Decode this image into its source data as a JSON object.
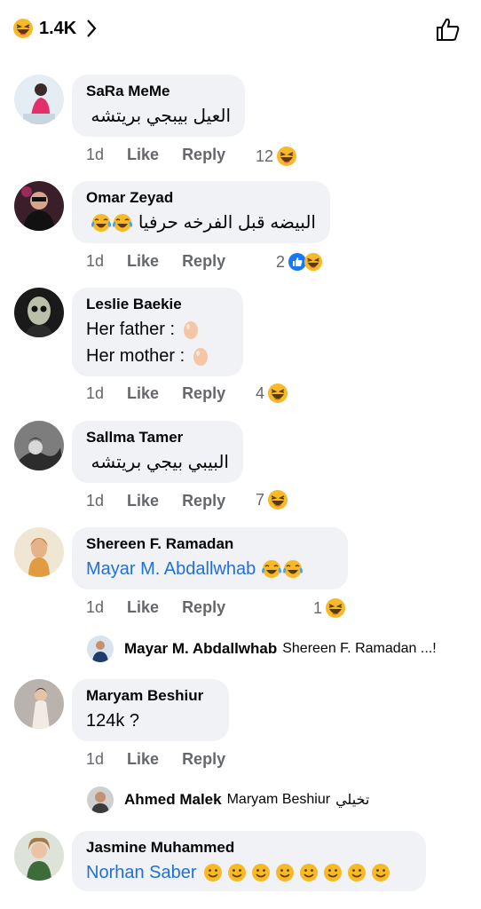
{
  "header": {
    "reaction_count": "1.4K"
  },
  "actions": {
    "time": "1d",
    "like": "Like",
    "reply": "Reply"
  },
  "comments": [
    {
      "name": "SaRa MeMe",
      "text": "العيل بيبجي بريتشه",
      "reactions": "12"
    },
    {
      "name": "Omar Zeyad",
      "text": "البيضه قبل الفرخه حرفيا",
      "reactions": "2"
    },
    {
      "name": "Leslie Baekie",
      "line1": "Her father :",
      "line2": "Her mother :",
      "reactions": "4"
    },
    {
      "name": "Sallma Tamer",
      "text": "البيبي بيجي بريتشه",
      "reactions": "7"
    },
    {
      "name": "Shereen F. Ramadan",
      "text": "Mayar M. Abdallwhab",
      "reactions": "1",
      "reply": {
        "name": "Mayar M. Abdallwhab",
        "text": "Shereen F. Ramadan ...!"
      }
    },
    {
      "name": "Maryam Beshiur",
      "text": "124k ?",
      "reply": {
        "name": "Ahmed Malek",
        "mention": "Maryam Beshiur",
        "text": "تخيلي"
      }
    },
    {
      "name": "Jasmine Muhammed",
      "text": "Norhan Saber"
    }
  ]
}
